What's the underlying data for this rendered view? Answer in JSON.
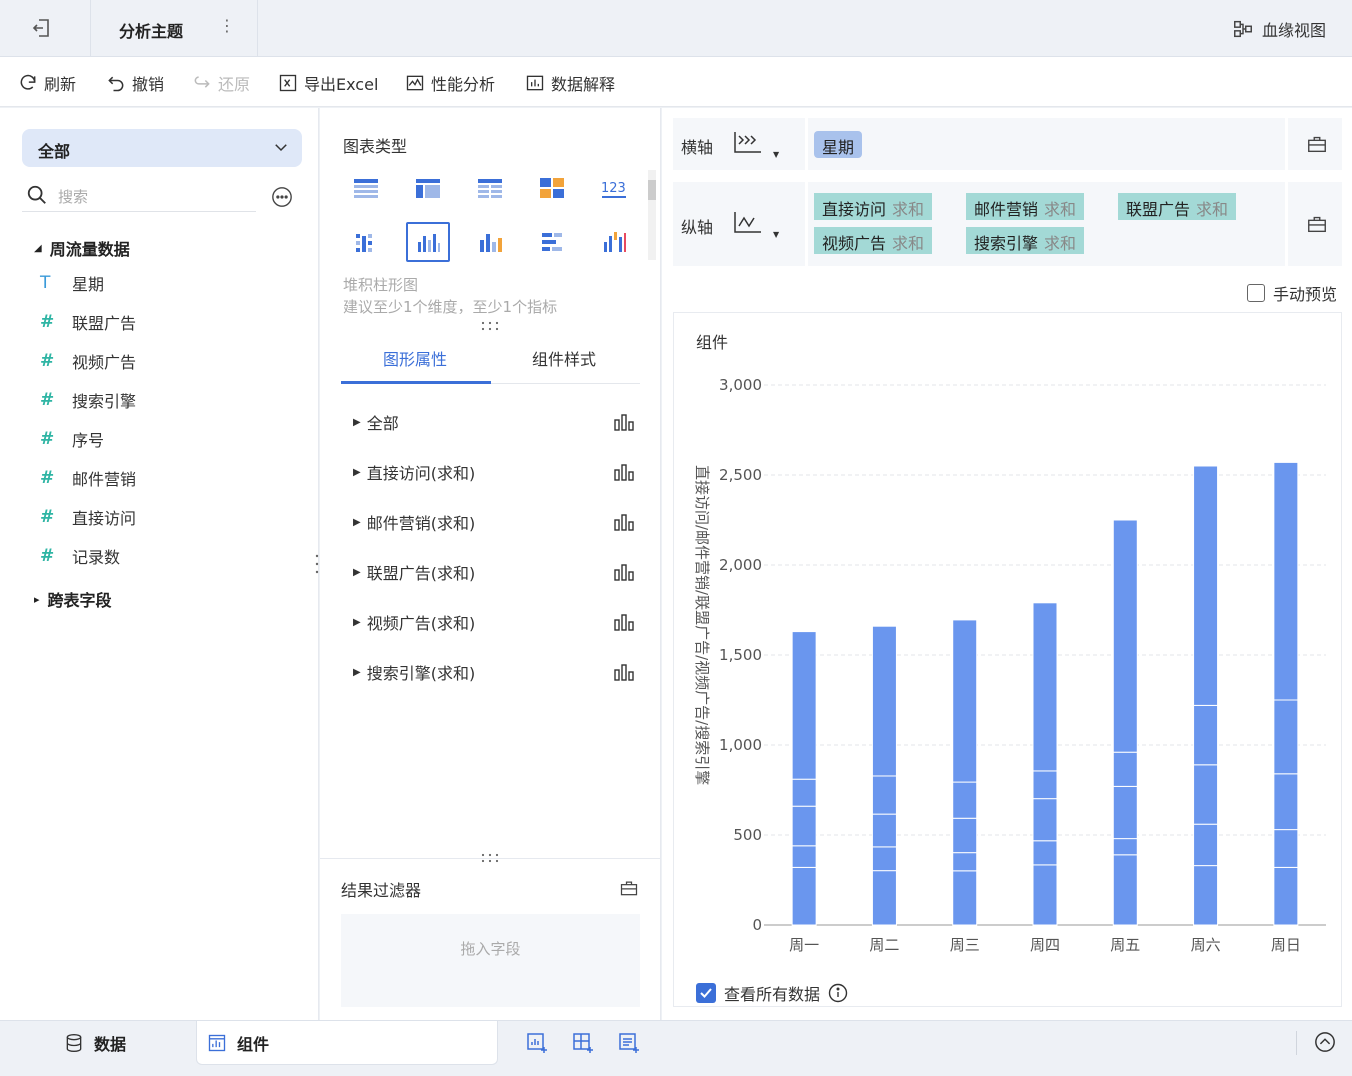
{
  "header": {
    "tab_title": "分析主题",
    "lineage_label": "血缘视图"
  },
  "toolbar": {
    "refresh": "刷新",
    "undo": "撤销",
    "redo": "还原",
    "export": "导出Excel",
    "perf": "性能分析",
    "explain": "数据解释"
  },
  "left": {
    "selector": "全部",
    "search_placeholder": "搜索",
    "group1": "周流量数据",
    "fields": [
      {
        "type": "T",
        "name": "星期"
      },
      {
        "type": "#",
        "name": "联盟广告"
      },
      {
        "type": "#",
        "name": "视频广告"
      },
      {
        "type": "#",
        "name": "搜索引擎"
      },
      {
        "type": "#",
        "name": "序号"
      },
      {
        "type": "#",
        "name": "邮件营销"
      },
      {
        "type": "#",
        "name": "直接访问"
      },
      {
        "type": "#",
        "name": "记录数"
      }
    ],
    "group2": "跨表字段"
  },
  "middle": {
    "chart_type_heading": "图表类型",
    "selected_chart": "堆积柱形图",
    "hint": "建议至少1个维度，至少1个指标",
    "tabs": [
      "图形属性",
      "组件样式"
    ],
    "props": [
      "全部",
      "直接访问(求和)",
      "邮件营销(求和)",
      "联盟广告(求和)",
      "视频广告(求和)",
      "搜索引擎(求和)"
    ],
    "filter_heading": "结果过滤器",
    "dropzone": "拖入字段"
  },
  "right": {
    "x_axis_label": "横轴",
    "y_axis_label": "纵轴",
    "x_fields": [
      "星期"
    ],
    "y_fields": [
      {
        "name": "直接访问",
        "agg": "求和"
      },
      {
        "name": "邮件营销",
        "agg": "求和"
      },
      {
        "name": "联盟广告",
        "agg": "求和"
      },
      {
        "name": "视频广告",
        "agg": "求和"
      },
      {
        "name": "搜索引擎",
        "agg": "求和"
      }
    ],
    "manual_preview": "手动预览",
    "component_title": "组件",
    "view_all": "查看所有数据"
  },
  "bottom": {
    "data_tab": "数据",
    "component_tab": "组件"
  },
  "colors": {
    "accent": "#3b6fd8",
    "bar": "#6a96ee",
    "dimension_pill": "#a9c2ec",
    "measure_pill": "#a3d9d6",
    "field_icon": "#2fb5a4"
  },
  "chart_data": {
    "type": "bar",
    "stacked": true,
    "categories": [
      "周一",
      "周二",
      "周三",
      "周四",
      "周五",
      "周六",
      "周日"
    ],
    "series": [
      {
        "name": "直接访问",
        "values": [
          320,
          302,
          301,
          334,
          390,
          330,
          320
        ]
      },
      {
        "name": "邮件营销",
        "values": [
          120,
          132,
          101,
          134,
          90,
          230,
          210
        ]
      },
      {
        "name": "联盟广告",
        "values": [
          220,
          182,
          191,
          234,
          290,
          330,
          310
        ]
      },
      {
        "name": "视频广告",
        "values": [
          150,
          212,
          201,
          154,
          190,
          330,
          410
        ]
      },
      {
        "name": "搜索引擎",
        "values": [
          820,
          832,
          901,
          934,
          1290,
          1330,
          1320
        ]
      }
    ],
    "ylabel": "直接访问/邮件营销/联盟广告/视频广告/搜索引擎",
    "ylim": [
      0,
      3000
    ],
    "yticks": [
      "0",
      "500",
      "1,000",
      "1,500",
      "2,000",
      "2,500",
      "3,000"
    ],
    "grid": true
  }
}
